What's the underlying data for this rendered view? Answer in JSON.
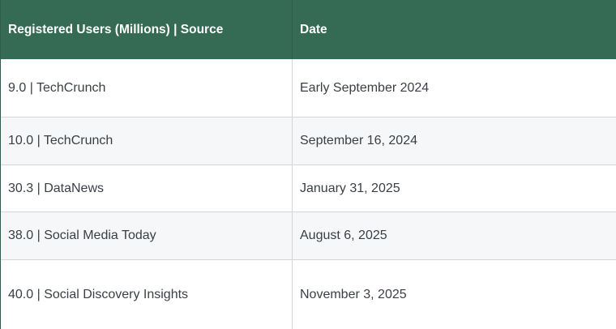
{
  "table": {
    "headers": [
      "Registered Users (Millions) | Source",
      "Date"
    ],
    "rows": [
      [
        "9.0 | TechCrunch",
        "Early September 2024"
      ],
      [
        "10.0 | TechCrunch",
        "September 16, 2024"
      ],
      [
        "30.3 | DataNews",
        "January 31, 2025"
      ],
      [
        "38.0 | Social Media Today",
        "August 6, 2025"
      ],
      [
        "40.0 | Social Discovery Insights",
        "November 3, 2025"
      ]
    ]
  },
  "colors": {
    "header_background": "#356a54",
    "header_text": "#ffffff",
    "row_alt_background": "#f6f7f8",
    "border": "#d2d6da",
    "text": "#3a3f44"
  }
}
